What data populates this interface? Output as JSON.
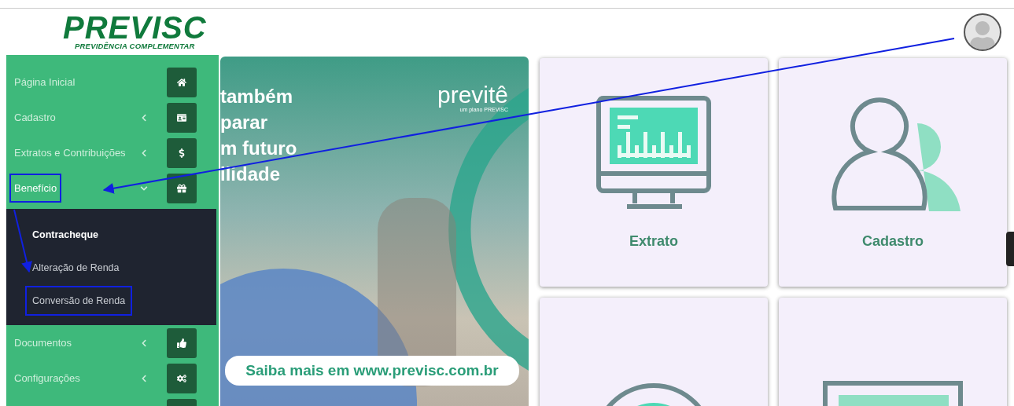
{
  "header": {
    "logo": {
      "name": "PREVISC",
      "tagline": "PREVIDÊNCIA COMPLEMENTAR"
    }
  },
  "sidebar": {
    "items": [
      {
        "label": "Página Inicial",
        "kind": "link",
        "highlighted": false
      },
      {
        "label": "Cadastro",
        "kind": "collapsed",
        "highlighted": false
      },
      {
        "label": "Extratos e Contribuições",
        "kind": "collapsed",
        "highlighted": false
      },
      {
        "label": "Benefício",
        "kind": "expanded",
        "highlighted": true,
        "children": [
          {
            "label": "Contracheque",
            "selected": true,
            "highlighted": false
          },
          {
            "label": "Alteração de Renda",
            "selected": false,
            "highlighted": false
          },
          {
            "label": "Conversão de Renda",
            "selected": false,
            "highlighted": true
          }
        ]
      },
      {
        "label": "Documentos",
        "kind": "collapsed",
        "highlighted": false
      },
      {
        "label": "Configurações",
        "kind": "collapsed",
        "highlighted": false
      }
    ]
  },
  "banner": {
    "headline": [
      "também",
      "parar",
      "m futuro",
      "ilidade"
    ],
    "brand": "previtê",
    "brand_tagline": "um plano PREVISC",
    "cta": "Saiba mais em www.previsc.com.br"
  },
  "cards": [
    {
      "label": "Extrato",
      "kind": "monitor"
    },
    {
      "label": "Cadastro",
      "kind": "person"
    },
    {
      "kind": "coin"
    },
    {
      "kind": "money"
    }
  ]
}
